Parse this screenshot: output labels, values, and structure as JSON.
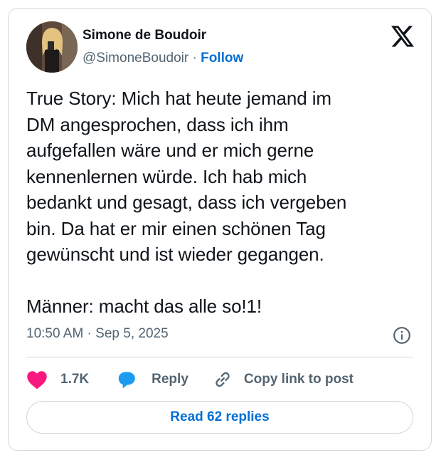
{
  "author": {
    "name": "Simone de Boudoir",
    "handle": "@SimoneBoudoir",
    "separator": "·",
    "follow_label": "Follow"
  },
  "tweet": {
    "text": "True Story: Mich hat heute jemand im\nDM angesprochen, dass ich ihm\naufgefallen wäre und er mich gerne\nkennenlernen würde. Ich hab mich\nbedankt und gesagt, dass ich vergeben\nbin. Da hat er mir einen schönen Tag\ngewünscht und ist wieder gegangen.\n\nMänner: macht das alle so!1!",
    "timestamp": "10:50 AM · Sep 5, 2025"
  },
  "actions": {
    "like_count": "1.7K",
    "reply_label": "Reply",
    "copy_label": "Copy link to post"
  },
  "read_replies_label": "Read 62 replies",
  "icons": {
    "logo": "x-logo-icon",
    "info": "info-icon",
    "like": "heart-icon",
    "reply": "speech-bubble-icon",
    "copy": "link-icon"
  },
  "colors": {
    "text": "#0f1419",
    "secondary": "#536471",
    "link": "#006fd6",
    "heart": "#f91880",
    "reply_bubble": "#1d9bf0",
    "border": "#cfd9de"
  }
}
